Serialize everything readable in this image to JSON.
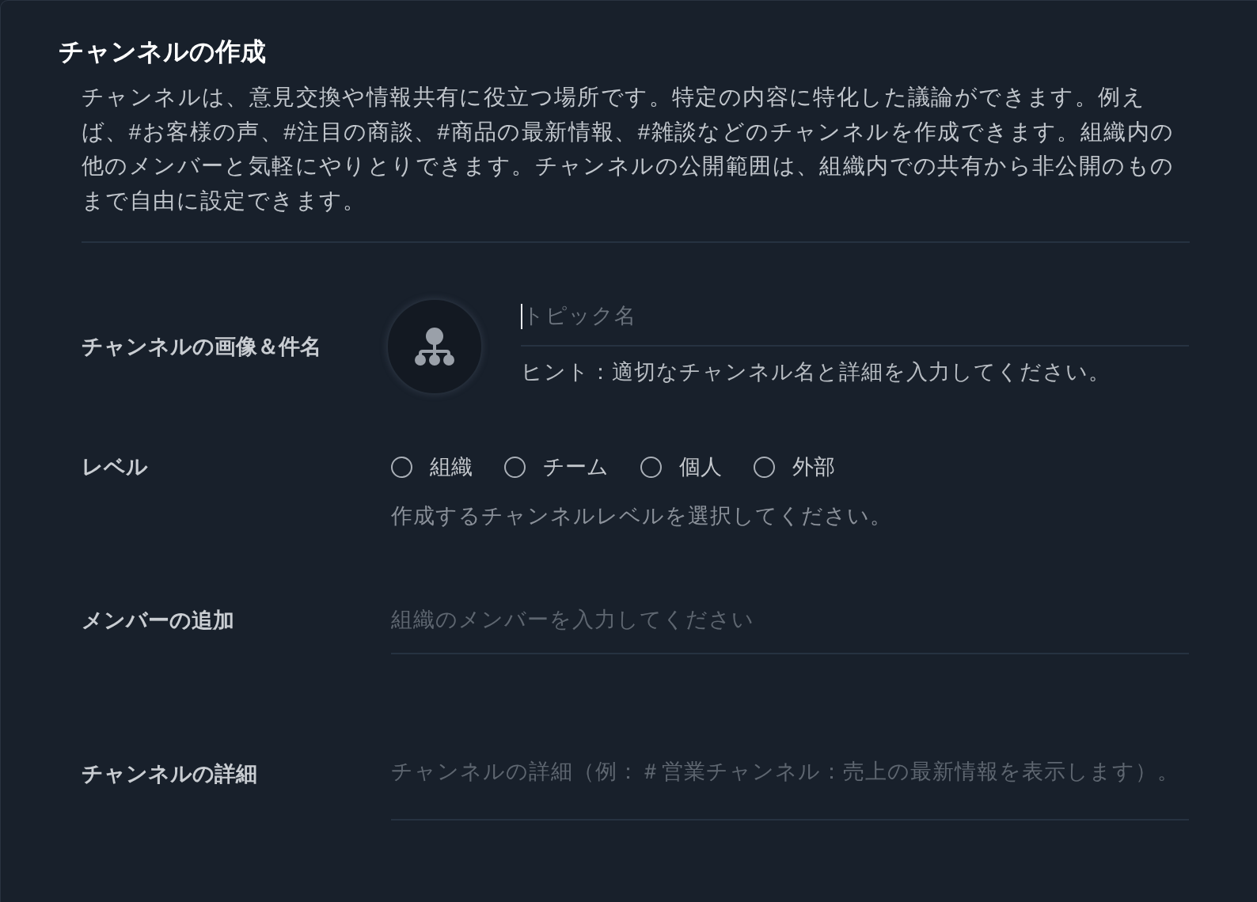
{
  "dialog": {
    "title": "チャンネルの作成",
    "description": "チャンネルは、意見交換や情報共有に役立つ場所です。特定の内容に特化した議論ができます。例えば、#お客様の声、#注目の商談、#商品の最新情報、#雑談などのチャンネルを作成できます。組織内の他のメンバーと気軽にやりとりできます。チャンネルの公開範囲は、組織内での共有から非公開のものまで自由に設定できます。"
  },
  "fields": [
    {
      "kind": "image_name",
      "label": "チャンネルの画像＆件名",
      "placeholder": "トピック名",
      "focused": true,
      "hint": "ヒント：適切なチャンネル名と詳細を入力してください。"
    },
    {
      "kind": "radio",
      "label": "レベル",
      "options": [
        {
          "label": "組織",
          "selected": false
        },
        {
          "label": "チーム",
          "selected": false
        },
        {
          "label": "個人",
          "selected": false
        },
        {
          "label": "外部",
          "selected": false
        }
      ],
      "hint": "作成するチャンネルレベルを選択してください。"
    },
    {
      "kind": "text",
      "label": "メンバーの追加",
      "placeholder": "組織のメンバーを入力してください"
    },
    {
      "kind": "textarea",
      "label": "チャンネルの詳細",
      "placeholder": "チャンネルの詳細（例：＃営業チャンネル：売上の最新情報を表示します）。"
    }
  ]
}
